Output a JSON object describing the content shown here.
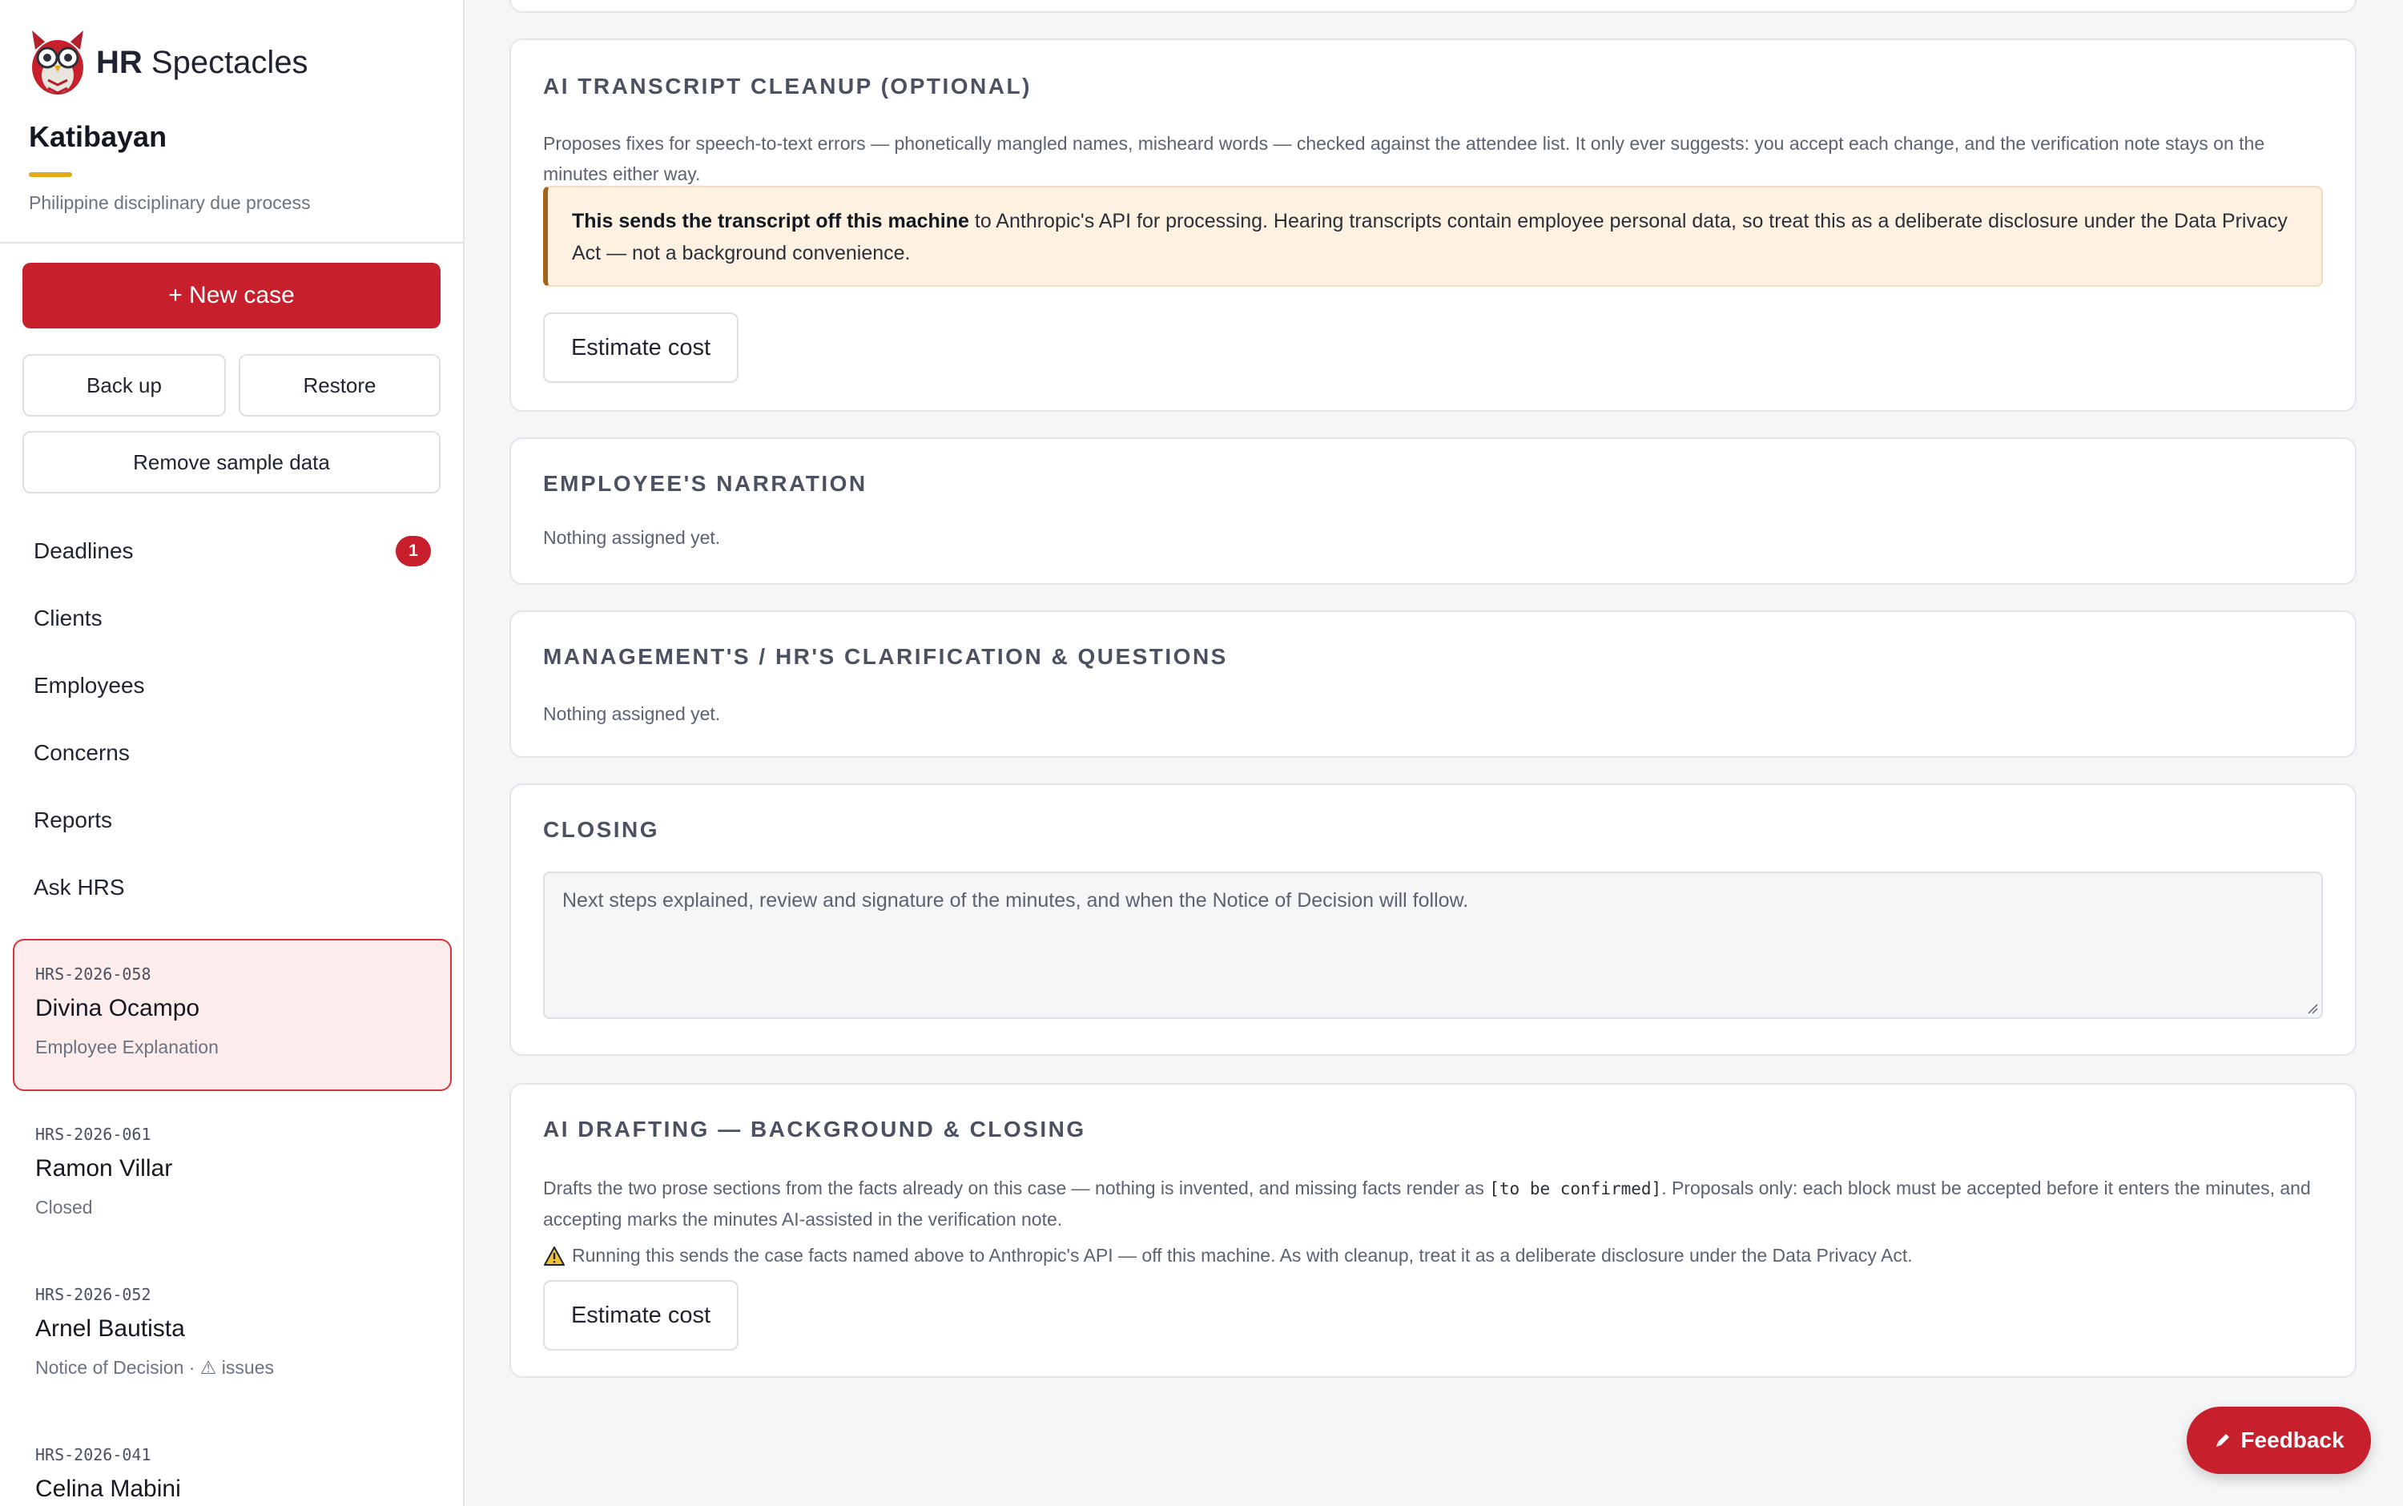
{
  "brand": {
    "name_bold": "HR",
    "name_rest": " Spectacles",
    "logo_icon": "owl-logo-icon"
  },
  "org": {
    "name": "Katibayan",
    "subtitle": "Philippine disciplinary due process"
  },
  "actions": {
    "new_case": "+ New case",
    "backup": "Back up",
    "restore": "Restore",
    "remove_sample": "Remove sample data"
  },
  "nav": [
    {
      "label": "Deadlines",
      "badge": "1"
    },
    {
      "label": "Clients"
    },
    {
      "label": "Employees"
    },
    {
      "label": "Concerns"
    },
    {
      "label": "Reports"
    },
    {
      "label": "Ask HRS"
    }
  ],
  "cases": [
    {
      "id": "HRS-2026-058",
      "name": "Divina Ocampo",
      "status": "Employee Explanation",
      "active": true
    },
    {
      "id": "HRS-2026-061",
      "name": "Ramon Villar",
      "status": "Closed"
    },
    {
      "id": "HRS-2026-052",
      "name": "Arnel Bautista",
      "status": "Notice of Decision · ⚠ issues"
    },
    {
      "id": "HRS-2026-041",
      "name": "Celina Mabini",
      "status": ""
    }
  ],
  "cleanup": {
    "title": "AI TRANSCRIPT CLEANUP (OPTIONAL)",
    "description": "Proposes fixes for speech-to-text errors — phonetically mangled names, misheard words — checked against the attendee list. It only ever suggests: you accept each change, and the verification note stays on the minutes either way.",
    "warning_bold": "This sends the transcript off this machine",
    "warning_rest": " to Anthropic's API for processing. Hearing transcripts contain employee personal data, so treat this as a deliberate disclosure under the Data Privacy Act — not a background convenience.",
    "button": "Estimate cost"
  },
  "narration": {
    "title": "EMPLOYEE'S NARRATION",
    "empty": "Nothing assigned yet."
  },
  "clarification": {
    "title": "MANAGEMENT'S / HR'S CLARIFICATION & QUESTIONS",
    "empty": "Nothing assigned yet."
  },
  "closing": {
    "title": "CLOSING",
    "placeholder": "Next steps explained, review and signature of the minutes, and when the Notice of Decision will follow."
  },
  "drafting": {
    "title": "AI DRAFTING — BACKGROUND & CLOSING",
    "description_before": "Drafts the two prose sections from the facts already on this case — nothing is invented, and missing facts render as ",
    "description_code": "[to be confirmed]",
    "description_after": ". Proposals only: each block must be accepted before it enters the minutes, and accepting marks the minutes AI-assisted in the verification note.",
    "warning": "Running this sends the case facts named above to Anthropic's API — off this machine. As with cleanup, treat it as a deliberate disclosure under the Data Privacy Act.",
    "button": "Estimate cost"
  },
  "feedback": {
    "label": "Feedback",
    "icon": "pencil-icon"
  },
  "colors": {
    "accent": "#c71f2c",
    "warning_border": "#a0651a",
    "warning_bg": "#fdf2e2",
    "underline": "#e3a81b"
  }
}
